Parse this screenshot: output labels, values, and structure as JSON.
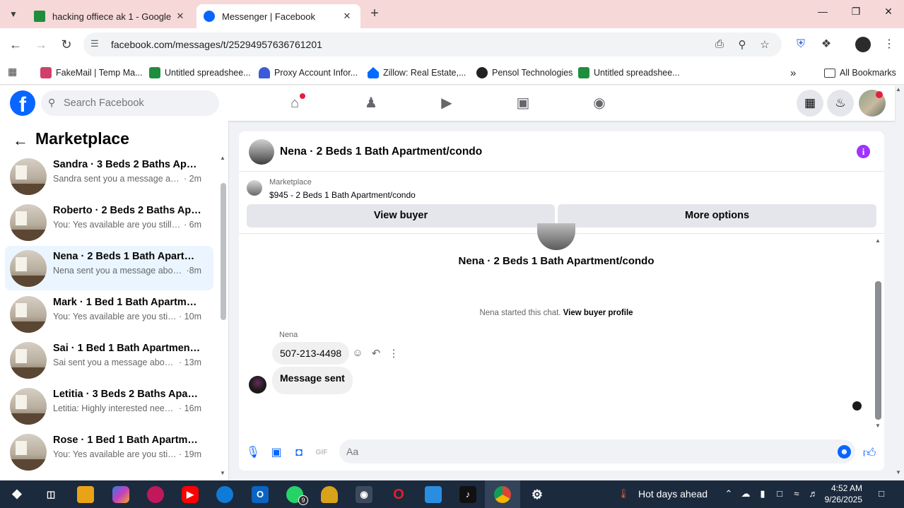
{
  "browser": {
    "tabs": [
      {
        "title": "hacking offiece ak 1 - Google D",
        "active": false,
        "favicon": "google-sheets-icon"
      },
      {
        "title": "Messenger | Facebook",
        "active": true,
        "favicon": "facebook-icon"
      }
    ],
    "url": "facebook.com/messages/t/25294957636761201",
    "bookmarks": [
      {
        "label": "FakeMail | Temp Ma...",
        "color": "#d0406a"
      },
      {
        "label": "Untitled spreadshee...",
        "color": "#1e8e3e"
      },
      {
        "label": "Proxy Account Infor...",
        "color": "#3b5bd9"
      },
      {
        "label": "Zillow: Real Estate,...",
        "color": "#006aff"
      },
      {
        "label": "Pensol Technologies",
        "color": "#222222"
      },
      {
        "label": "Untitled spreadshee...",
        "color": "#1e8e3e"
      }
    ],
    "all_bookmarks_label": "All Bookmarks"
  },
  "facebook": {
    "search_placeholder": "Search Facebook",
    "brand_color": "#0866ff"
  },
  "sidebar": {
    "title": "Marketplace",
    "conversations": [
      {
        "name": "Sandra · 3 Beds 2 Baths Apartm...",
        "snippet": "Sandra sent you a message about ...",
        "time": "· 2m",
        "selected": false
      },
      {
        "name": "Roberto · 2 Beds 2 Baths Apart...",
        "snippet": "You: Yes available are you still inter...",
        "time": "· 6m",
        "selected": false
      },
      {
        "name": "Nena · 2 Beds 1 Bath Apartment...",
        "snippet": "Nena sent you a message about y...",
        "time": "·8m",
        "selected": true
      },
      {
        "name": "Mark · 1 Bed 1 Bath Apartment/...",
        "snippet": "You: Yes available are you still int...",
        "time": "· 10m",
        "selected": false
      },
      {
        "name": "Sai · 1 Bed 1 Bath Apartment/co...",
        "snippet": "Sai sent you a message about yo...",
        "time": "· 13m",
        "selected": false
      },
      {
        "name": "Letitia · 3 Beds 2 Baths Apartme...",
        "snippet": "Letitia: Highly interested need to ...",
        "time": "· 16m",
        "selected": false
      },
      {
        "name": "Rose · 1 Bed 1 Bath Apartment/c...",
        "snippet": "You: Yes available are you still int...",
        "time": "· 19m",
        "selected": false
      }
    ]
  },
  "chat": {
    "header_title": "Nena · 2 Beds 1 Bath Apartment/condo",
    "marketplace_label": "Marketplace",
    "listing": "$945 - 2 Beds 1 Bath Apartment/condo",
    "view_buyer_label": "View buyer",
    "more_options_label": "More options",
    "thread_title": "Nena · 2 Beds 1 Bath Apartment/condo",
    "started_text": "Nena started this chat.",
    "view_buyer_profile_label": "View buyer profile",
    "sender_name": "Nena",
    "messages": [
      {
        "text": "507-213-4498"
      },
      {
        "text": "Message sent"
      }
    ],
    "composer_placeholder": "Aa"
  },
  "taskbar": {
    "weather": "Hot days ahead",
    "time": "4:52 AM",
    "date": "9/26/2025",
    "whatsapp_badge": "9"
  }
}
